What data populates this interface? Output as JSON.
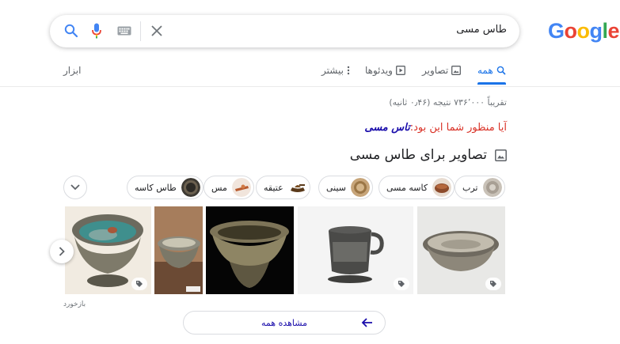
{
  "search": {
    "query": "طاس مسی"
  },
  "logo": {
    "letters": [
      "G",
      "o",
      "o",
      "g",
      "l",
      "e"
    ],
    "colors": [
      "#4285f4",
      "#ea4335",
      "#fbbc05",
      "#4285f4",
      "#34a853",
      "#ea4335"
    ]
  },
  "tabs": {
    "all": "همه",
    "images": "تصاویر",
    "videos": "ویدئوها",
    "more": "بیشتر",
    "tools": "ابزار"
  },
  "result_stats": "تقریباً ۷۳۶٬۰۰۰ نتیجه (۰٫۴۶ ثانیه)",
  "did_you_mean": {
    "prefix": "آیا منظور شما این بود:",
    "suggestion_bold": "تاس",
    "suggestion_rest": " مسی"
  },
  "images_section": {
    "heading": "تصاویر برای طاس مسی"
  },
  "chips": [
    {
      "label": "ترب"
    },
    {
      "label": "کاسه مسی"
    },
    {
      "label": "سینی"
    },
    {
      "label": "عتیقه"
    },
    {
      "label": "مس"
    },
    {
      "label": "طاس کاسه"
    }
  ],
  "feedback": "بازخورد",
  "view_all": "مشاهده همه",
  "colors": {
    "accent": "#1a73e8",
    "link": "#1a0dab",
    "didyoumean": "#d93025"
  }
}
